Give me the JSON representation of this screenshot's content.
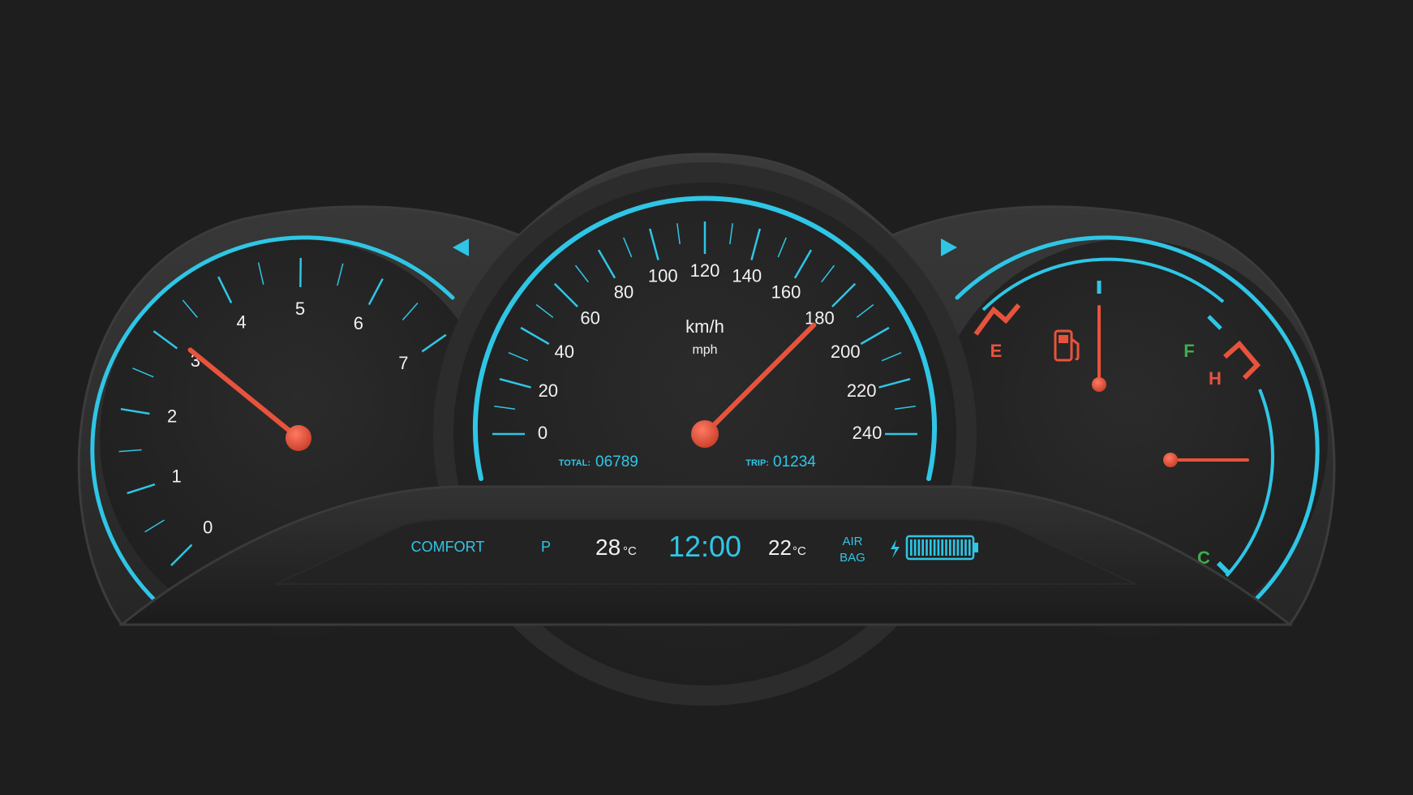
{
  "colors": {
    "background": "#1e1e1e",
    "bezel": "#2e2e2e",
    "dial_face": "#262626",
    "accent_cyan": "#2fc6e6",
    "needle_red": "#e8533c",
    "text_white": "#f2f2f2",
    "fuel_full_green": "#3fae4b"
  },
  "tachometer": {
    "labels": [
      "0",
      "1",
      "2",
      "3",
      "4",
      "5",
      "6",
      "7"
    ],
    "needle_value": 3.1
  },
  "speedometer": {
    "unit_primary": "km/h",
    "unit_secondary": "mph",
    "labels": [
      "0",
      "20",
      "40",
      "60",
      "80",
      "100",
      "120",
      "140",
      "160",
      "180",
      "200",
      "220",
      "240"
    ],
    "needle_value": 180,
    "odometer": {
      "total_label": "TOTAL:",
      "total_value": "06789",
      "trip_label": "TRIP:",
      "trip_value": "01234"
    }
  },
  "fuel_gauge": {
    "empty_label": "E",
    "full_label": "F",
    "icon": "fuel-pump-icon",
    "level": 0.5
  },
  "temperature_gauge": {
    "hot_label": "H",
    "cold_label": "C",
    "level": 0.5
  },
  "indicators": {
    "left_turn": "left-turn-arrow-icon",
    "right_turn": "right-turn-arrow-icon"
  },
  "info_display": {
    "drive_mode": "COMFORT",
    "gear": "P",
    "outside_temp": "28",
    "outside_temp_unit": "°C",
    "clock": "12:00",
    "inside_temp": "22",
    "inside_temp_unit": "°C",
    "airbag_line1": "AIR",
    "airbag_line2": "BAG",
    "battery_icon": "battery-icon",
    "charge_icon": "lightning-icon",
    "battery_level": 1.0
  }
}
